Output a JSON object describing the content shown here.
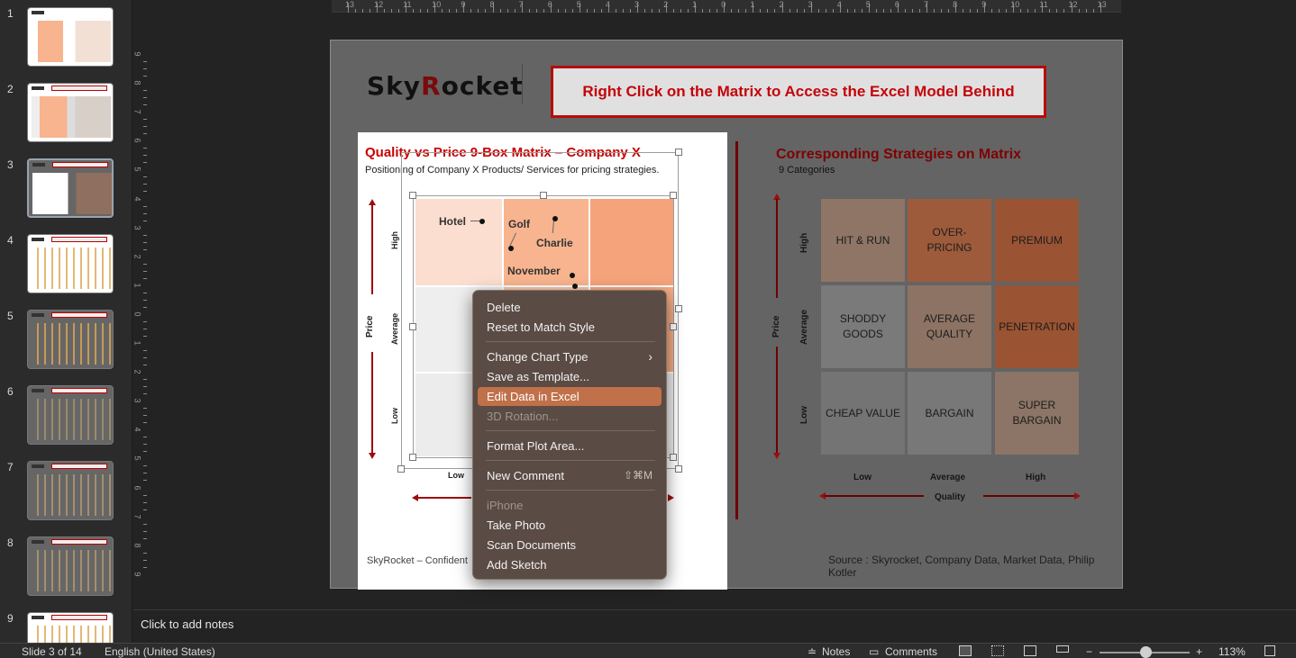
{
  "thumbnails": [
    {
      "num": "1"
    },
    {
      "num": "2"
    },
    {
      "num": "3"
    },
    {
      "num": "4"
    },
    {
      "num": "5"
    },
    {
      "num": "6"
    },
    {
      "num": "7"
    },
    {
      "num": "8"
    },
    {
      "num": "9"
    }
  ],
  "rulers": {
    "horizontal": [
      "13",
      "12",
      "11",
      "10",
      "9",
      "8",
      "7",
      "6",
      "5",
      "4",
      "3",
      "2",
      "1",
      "0",
      "1",
      "2",
      "3",
      "4",
      "5",
      "6",
      "7",
      "8",
      "9",
      "10",
      "11",
      "12",
      "13"
    ],
    "vertical": [
      "9",
      "8",
      "7",
      "6",
      "5",
      "4",
      "3",
      "2",
      "1",
      "0",
      "1",
      "2",
      "3",
      "4",
      "5",
      "6",
      "7",
      "8",
      "9"
    ]
  },
  "slide": {
    "logo_prefix": "Sky",
    "logo_r": "R",
    "logo_suffix": "ocket",
    "banner": "Right Click on the Matrix to Access the Excel Model Behind",
    "left": {
      "title": "Quality vs Price 9-Box Matrix – Company X",
      "subtitle": "Positioning of Company X Products/ Services for pricing strategies.",
      "y_axis": "Price",
      "y_high": "High",
      "y_avg": "Average",
      "y_low": "Low",
      "x_low": "Low",
      "footer": "SkyRocket – Confident"
    },
    "right": {
      "title": "Corresponding Strategies on Matrix",
      "subtitle": "9 Categories",
      "y_axis": "Price",
      "y_high": "High",
      "y_avg": "Average",
      "y_low": "Low",
      "x_low": "Low",
      "x_avg": "Average",
      "x_high": "High",
      "x_axis": "Quality",
      "cells": [
        {
          "label": "HIT & RUN",
          "color": "#8e7566"
        },
        {
          "label": "OVER-PRICING",
          "color": "#9e5b3c"
        },
        {
          "label": "PREMIUM",
          "color": "#9a5333"
        },
        {
          "label": "SHODDY GOODS",
          "color": "#7a7a7a"
        },
        {
          "label": "AVERAGE QUALITY",
          "color": "#8d7364"
        },
        {
          "label": "PENETRATION",
          "color": "#9a5333"
        },
        {
          "label": "CHEAP VALUE",
          "color": "#747474"
        },
        {
          "label": "BARGAIN",
          "color": "#787878"
        },
        {
          "label": "SUPER BARGAIN",
          "color": "#8c7566"
        }
      ],
      "source": "Source : Skyrocket, Company Data, Market Data, Philip Kotler"
    },
    "points": [
      {
        "label": "Hotel"
      },
      {
        "label": "Golf"
      },
      {
        "label": "Charlie"
      },
      {
        "label": "November"
      }
    ],
    "matrix_colors": {
      "high_low": "#fbdecf",
      "high_avg": "#f7b48f",
      "high_high": "#f4a37a",
      "avg_low": "#eeeeee",
      "avg_high": "#f5ab83",
      "low": "#ececec"
    }
  },
  "context_menu": {
    "items": [
      {
        "label": "Delete"
      },
      {
        "label": "Reset to Match Style"
      },
      {
        "label": "Change Chart Type"
      },
      {
        "label": "Save as Template..."
      },
      {
        "label": "Edit Data in Excel"
      },
      {
        "label": "3D Rotation..."
      },
      {
        "label": "Format Plot Area..."
      },
      {
        "label": "New Comment",
        "shortcut": "⇧⌘M"
      },
      {
        "label": "iPhone"
      },
      {
        "label": "Take Photo"
      },
      {
        "label": "Scan Documents"
      },
      {
        "label": "Add Sketch"
      }
    ]
  },
  "notes_placeholder": "Click to add notes",
  "status": {
    "slide": "Slide 3 of 14",
    "language": "English (United States)",
    "notes": "Notes",
    "comments": "Comments",
    "zoom": "113%"
  }
}
